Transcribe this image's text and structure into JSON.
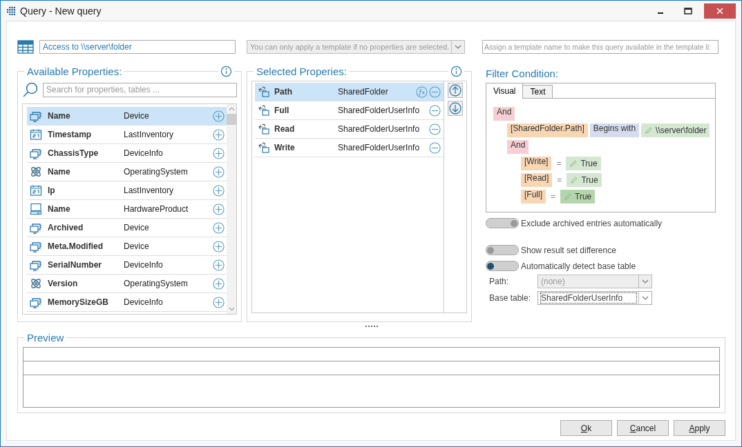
{
  "window": {
    "title": "Query - New query"
  },
  "header": {
    "query_name": "Access to \\\\server\\folder",
    "template_select": {
      "placeholder": "You can only apply a template if no properties are selected.",
      "disabled": true
    },
    "template_name": {
      "placeholder": "Assign a template name to make this query available in the template li:"
    }
  },
  "available": {
    "title": "Available Properties:",
    "search": {
      "placeholder": "Search for properties, tables ..."
    },
    "rows": [
      {
        "kind": "device",
        "name": "Name",
        "table": "Device",
        "selected": true
      },
      {
        "kind": "calendar",
        "name": "Timestamp",
        "table": "LastInventory",
        "selected": false
      },
      {
        "kind": "device",
        "name": "ChassisType",
        "table": "DeviceInfo",
        "selected": false
      },
      {
        "kind": "atom",
        "name": "Name",
        "table": "OperatingSystem",
        "selected": false
      },
      {
        "kind": "calendar",
        "name": "Ip",
        "table": "LastInventory",
        "selected": false
      },
      {
        "kind": "computer",
        "name": "Name",
        "table": "HardwareProduct",
        "selected": false
      },
      {
        "kind": "device",
        "name": "Archived",
        "table": "Device",
        "selected": false
      },
      {
        "kind": "device",
        "name": "Meta.Modified",
        "table": "Device",
        "selected": false
      },
      {
        "kind": "device",
        "name": "SerialNumber",
        "table": "DeviceInfo",
        "selected": false
      },
      {
        "kind": "atom",
        "name": "Version",
        "table": "OperatingSystem",
        "selected": false
      },
      {
        "kind": "device",
        "name": "MemorySizeGB",
        "table": "DeviceInfo",
        "selected": false
      }
    ]
  },
  "selected": {
    "title": "Selected Properies:",
    "rows": [
      {
        "kind": "share",
        "name": "Path",
        "table": "SharedFolder",
        "selected": true,
        "function": true
      },
      {
        "kind": "share",
        "name": "Full",
        "table": "SharedFolderUserInfo",
        "selected": false,
        "function": false
      },
      {
        "kind": "share",
        "name": "Read",
        "table": "SharedFolderUserInfo",
        "selected": false,
        "function": false
      },
      {
        "kind": "share",
        "name": "Write",
        "table": "SharedFolderUserInfo",
        "selected": false,
        "function": false
      }
    ]
  },
  "filter": {
    "title": "Filter Condition:",
    "tabs": [
      {
        "label": "Visual",
        "selected": true
      },
      {
        "label": "Text",
        "selected": false
      }
    ],
    "tree": {
      "kind": "group",
      "op": "And",
      "children": [
        {
          "kind": "condition",
          "field": "[SharedFolder.Path]",
          "operator": "Begins with",
          "value": "\\\\server\\folder",
          "highlighted": false
        },
        {
          "kind": "group",
          "op": "And",
          "children": [
            {
              "kind": "equality",
              "field": "[Write]",
              "operator": "=",
              "value": "True",
              "highlighted": false
            },
            {
              "kind": "equality",
              "field": "[Read]",
              "operator": "=",
              "value": "True",
              "highlighted": false
            },
            {
              "kind": "equality",
              "field": "[Full]",
              "operator": "=",
              "value": "True",
              "highlighted": true
            }
          ]
        }
      ]
    },
    "toggles": [
      {
        "label": "Exclude archived entries automatically",
        "on": true,
        "focused": false
      },
      {
        "label": "Show result set difference",
        "on": false,
        "focused": false
      },
      {
        "label": "Automatically detect base table",
        "on": false,
        "focused": true
      }
    ],
    "fields": [
      {
        "label": "Path:",
        "value": "(none)",
        "disabled": true
      },
      {
        "label": "Base table:",
        "value": "SharedFolderUserInfo",
        "disabled": false
      }
    ]
  },
  "preview": {
    "title": "Preview"
  },
  "buttons": [
    {
      "accel": "O",
      "rest": "k"
    },
    {
      "accel": "C",
      "rest": "ancel"
    },
    {
      "accel": "A",
      "rest": "pply"
    }
  ]
}
